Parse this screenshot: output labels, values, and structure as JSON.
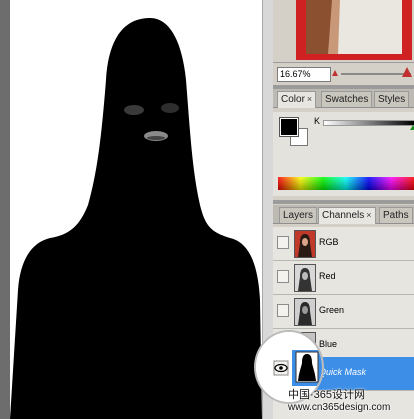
{
  "navigator": {
    "zoom": "16.67%"
  },
  "color_panel": {
    "tabs": [
      {
        "label": "Color",
        "close": "×"
      },
      {
        "label": "Swatches",
        "close": ""
      },
      {
        "label": "Styles",
        "close": ""
      }
    ],
    "slider_label": "K",
    "foreground": "#000000",
    "background": "#ffffff"
  },
  "channels_panel": {
    "tabs": [
      {
        "label": "Layers",
        "close": ""
      },
      {
        "label": "Channels",
        "close": "×"
      },
      {
        "label": "Paths",
        "close": ""
      }
    ],
    "channels": [
      {
        "label": "RGB",
        "visible": false,
        "selected": false
      },
      {
        "label": "Red",
        "visible": false,
        "selected": false
      },
      {
        "label": "Green",
        "visible": false,
        "selected": false
      },
      {
        "label": "Blue",
        "visible": false,
        "selected": false
      },
      {
        "label": "Quick Mask",
        "visible": true,
        "selected": true
      }
    ]
  },
  "watermark": {
    "line1": "中国·365设计网",
    "line2": "www.cn365design.com"
  },
  "colors": {
    "selection": "#3d8ee6",
    "accent": "#cf2121"
  }
}
